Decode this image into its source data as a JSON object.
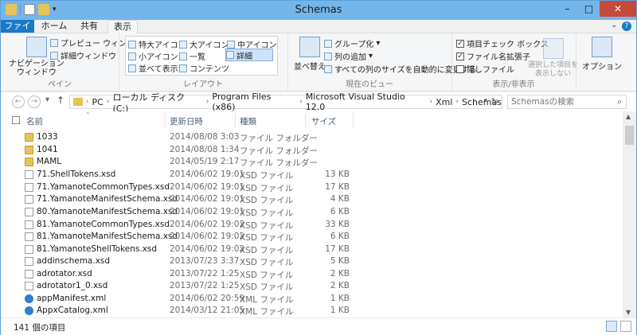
{
  "window": {
    "title": "Schemas"
  },
  "tabs": [
    {
      "label": "ファイル"
    },
    {
      "label": "ホーム"
    },
    {
      "label": "共有"
    },
    {
      "label": "表示"
    }
  ],
  "ribbon": {
    "pane": {
      "nav_pane": "ナビゲーション\nウィンドウ",
      "preview": "プレビュー ウィンドウ",
      "details": "詳細ウィンドウ",
      "label": "ペイン"
    },
    "layout": {
      "items": [
        "特大アイコン",
        "大アイコン",
        "中アイコン",
        "小アイコン",
        "一覧",
        "詳細",
        "並べて表示",
        "コンテンツ"
      ],
      "selected": "詳細",
      "label": "レイアウト"
    },
    "current_view": {
      "sort": "並べ替え",
      "group": "グループ化",
      "add_column": "列の追加",
      "autosize": "すべての列のサイズを自動的に変更する",
      "label": "現在のビュー"
    },
    "show_hide": {
      "item_checkbox": "項目チェック ボックス",
      "extensions": "ファイル名拡張子",
      "hidden": "隠しファイル",
      "hide_selected": "選択した項目を\n表示しない",
      "label": "表示/非表示"
    },
    "options": {
      "label": "オプション"
    }
  },
  "address": {
    "crumbs": [
      "PC",
      "ローカル ディスク (C:)",
      "Program Files (x86)",
      "Microsoft Visual Studio 12.0",
      "Xml",
      "Schemas"
    ],
    "search_placeholder": "Schemasの検索"
  },
  "columns": {
    "name": "名前",
    "date": "更新日時",
    "type": "種類",
    "size": "サイズ"
  },
  "files": [
    {
      "icon": "folder",
      "name": "1033",
      "date": "2014/08/08 3:03",
      "type": "ファイル フォルダー",
      "size": ""
    },
    {
      "icon": "folder",
      "name": "1041",
      "date": "2014/08/08 1:34",
      "type": "ファイル フォルダー",
      "size": ""
    },
    {
      "icon": "folder",
      "name": "MAML",
      "date": "2014/05/19 2:17",
      "type": "ファイル フォルダー",
      "size": ""
    },
    {
      "icon": "xsd",
      "name": "71.ShellTokens.xsd",
      "date": "2014/06/02 19:01",
      "type": "XSD ファイル",
      "size": "13 KB"
    },
    {
      "icon": "xsd",
      "name": "71.YamanoteCommonTypes.xsd",
      "date": "2014/06/02 19:01",
      "type": "XSD ファイル",
      "size": "17 KB"
    },
    {
      "icon": "xsd",
      "name": "71.YamanoteManifestSchema.xsd",
      "date": "2014/06/02 19:01",
      "type": "XSD ファイル",
      "size": "4 KB"
    },
    {
      "icon": "xsd",
      "name": "80.YamanoteManifestSchema.xsd",
      "date": "2014/06/02 19:01",
      "type": "XSD ファイル",
      "size": "6 KB"
    },
    {
      "icon": "xsd",
      "name": "81.YamanoteCommonTypes.xsd",
      "date": "2014/06/02 19:02",
      "type": "XSD ファイル",
      "size": "33 KB"
    },
    {
      "icon": "xsd",
      "name": "81.YamanoteManifestSchema.xsd",
      "date": "2014/06/02 19:02",
      "type": "XSD ファイル",
      "size": "6 KB"
    },
    {
      "icon": "xsd",
      "name": "81.YamanoteShellTokens.xsd",
      "date": "2014/06/02 19:02",
      "type": "XSD ファイル",
      "size": "17 KB"
    },
    {
      "icon": "xsd",
      "name": "addinschema.xsd",
      "date": "2013/07/23 3:37",
      "type": "XSD ファイル",
      "size": "5 KB"
    },
    {
      "icon": "xsd",
      "name": "adrotator.xsd",
      "date": "2013/07/22 1:25",
      "type": "XSD ファイル",
      "size": "2 KB"
    },
    {
      "icon": "xsd",
      "name": "adrotator1_0.xsd",
      "date": "2013/07/22 1:25",
      "type": "XSD ファイル",
      "size": "2 KB"
    },
    {
      "icon": "xml",
      "name": "appManifest.xml",
      "date": "2014/06/02 20:59",
      "type": "XML ファイル",
      "size": "1 KB"
    },
    {
      "icon": "xml",
      "name": "AppxCatalog.xml",
      "date": "2014/03/12 21:05",
      "type": "XML ファイル",
      "size": "1 KB"
    }
  ],
  "status": {
    "count": "141 個の項目"
  }
}
